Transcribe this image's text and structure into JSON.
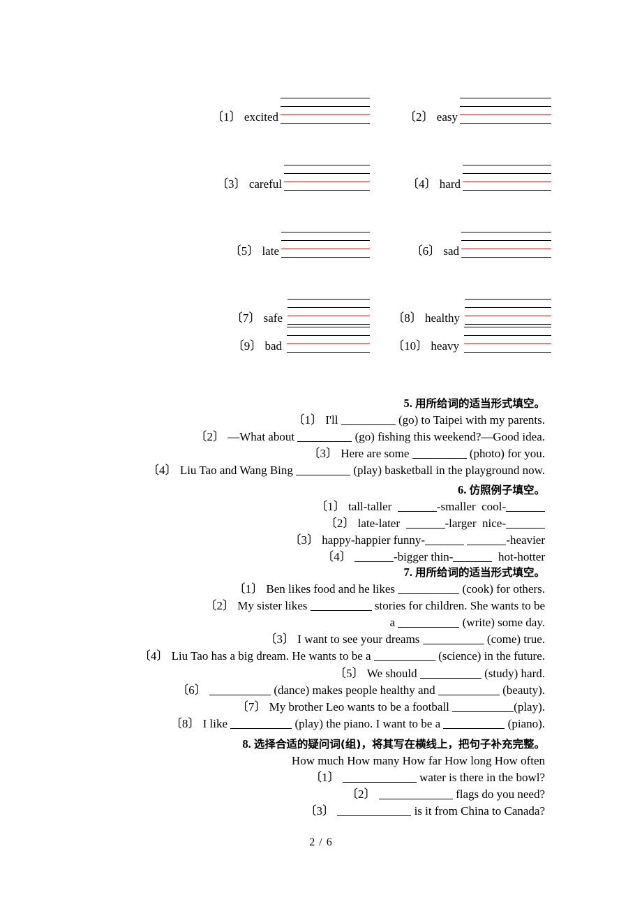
{
  "document": {
    "footer_page": "2 / 6"
  },
  "word_exercise": {
    "items": [
      {
        "num": "〔1〕",
        "word": "excited"
      },
      {
        "num": "〔2〕",
        "word": "easy"
      },
      {
        "num": "〔3〕",
        "word": "careful"
      },
      {
        "num": "〔4〕",
        "word": "hard"
      },
      {
        "num": "〔5〕",
        "word": "late"
      },
      {
        "num": "〔6〕",
        "word": "sad"
      },
      {
        "num": "〔7〕",
        "word": "safe"
      },
      {
        "num": "〔8〕",
        "word": "healthy"
      },
      {
        "num": "〔9〕",
        "word": "bad"
      },
      {
        "num": "〔10〕",
        "word": "heavy"
      }
    ],
    "line_colors": [
      "#000000",
      "#000000",
      "#ee0000",
      "#000000"
    ]
  },
  "sections": {
    "s5": {
      "number": "5.",
      "title": "用所给词的适当形式填空。",
      "items": [
        {
          "num": "〔1〕",
          "a": "I'll",
          "b": "(go) to Taipei with my parents."
        },
        {
          "num": "〔2〕",
          "a": "—What about",
          "b": "(go) fishing this weekend?—Good idea."
        },
        {
          "num": "〔3〕",
          "a": "Here are some",
          "b": "(photo) for you."
        },
        {
          "num": "〔4〕",
          "a": "Liu Tao and Wang Bing",
          "b": "(play) basketball in the playground now."
        }
      ]
    },
    "s6": {
      "number": "6.",
      "title": "仿照例子填空。",
      "items": [
        {
          "num": "〔1〕",
          "p1": "tall-taller",
          "p2": "-smaller",
          "p3": "cool-"
        },
        {
          "num": "〔2〕",
          "p1": "late-later",
          "p2": "-larger",
          "p3": "nice-"
        },
        {
          "num": "〔3〕",
          "p1": "happy-happier funny-",
          "p2": "",
          "p3": "-heavier"
        },
        {
          "num": "〔4〕",
          "p1": "",
          "p2": "-bigger thin-",
          "p3": "hot-hotter"
        }
      ]
    },
    "s7": {
      "number": "7.",
      "title": "用所给词的适当形式填空。",
      "items": [
        {
          "num": "〔1〕",
          "a": "Ben likes food and he likes",
          "b": "(cook) for others."
        },
        {
          "num": "〔2〕",
          "a": "My sister likes",
          "b": "stories for children. She wants to be",
          "c": "a",
          "d": "(write) some day."
        },
        {
          "num": "〔3〕",
          "a": "I want to see your dreams",
          "b": "(come) true."
        },
        {
          "num": "〔4〕",
          "a": "Liu Tao has a big dream. He wants to be a",
          "b": "(science) in the future."
        },
        {
          "num": "〔5〕",
          "a": "We should",
          "b": "(study) hard."
        },
        {
          "num": "〔6〕",
          "a": "",
          "b": "(dance) makes people healthy and",
          "c": "(beauty)."
        },
        {
          "num": "〔7〕",
          "a": "My brother Leo wants to be a football",
          "b": "(play)."
        },
        {
          "num": "〔8〕",
          "a": "I like",
          "b": "(play) the piano. I want to be a",
          "c": "(piano)."
        }
      ]
    },
    "s8": {
      "number": "8.",
      "title": "选择合适的疑问词(组)，将其写在横线上，把句子补充完整。",
      "word_bank": "How much How many How far How long How often",
      "items": [
        {
          "num": "〔1〕",
          "b": "water is there in the bowl?"
        },
        {
          "num": "〔2〕",
          "b": "flags do you need?"
        },
        {
          "num": "〔3〕",
          "b": "is it from China to Canada?"
        }
      ]
    }
  }
}
